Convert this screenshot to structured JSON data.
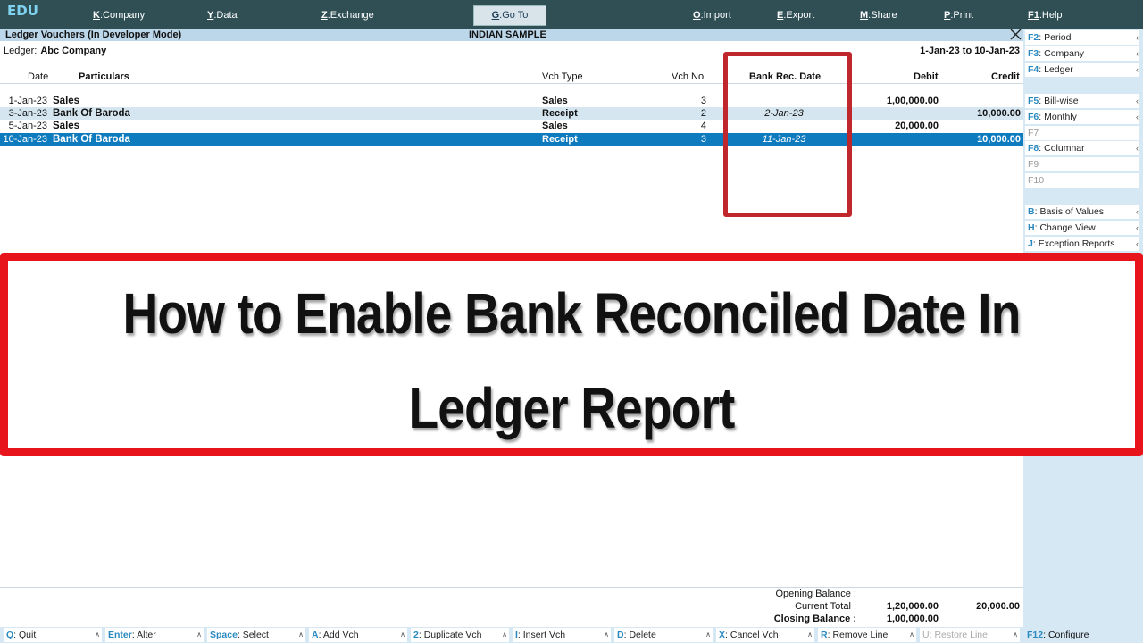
{
  "top": {
    "logo": "EDU",
    "menus": [
      {
        "key": "K",
        "label": "Company"
      },
      {
        "key": "Y",
        "label": "Data"
      },
      {
        "key": "Z",
        "label": "Exchange"
      },
      {
        "key": "G",
        "label": "Go To"
      },
      {
        "key": "O",
        "label": "Import"
      },
      {
        "key": "E",
        "label": "Export"
      },
      {
        "key": "M",
        "label": "Share"
      },
      {
        "key": "P",
        "label": "Print"
      },
      {
        "key": "F1",
        "label": "Help"
      }
    ]
  },
  "title": {
    "screen": "Ledger Vouchers (In Developer Mode)",
    "company": "INDIAN SAMPLE"
  },
  "ledger": {
    "label": "Ledger:",
    "name": "Abc Company",
    "period": "1-Jan-23 to 10-Jan-23"
  },
  "columns": {
    "date": "Date",
    "particulars": "Particulars",
    "vch_type": "Vch Type",
    "vch_no": "Vch No.",
    "bank_rec": "Bank Rec. Date",
    "debit": "Debit",
    "credit": "Credit"
  },
  "rows": [
    {
      "date": "1-Jan-23",
      "particulars": "Sales",
      "vch_type": "Sales",
      "vch_no": "3",
      "bank_rec": "",
      "debit": "1,00,000.00",
      "credit": ""
    },
    {
      "date": "3-Jan-23",
      "particulars": "Bank Of Baroda",
      "vch_type": "Receipt",
      "vch_no": "2",
      "bank_rec": "2-Jan-23",
      "debit": "",
      "credit": "10,000.00"
    },
    {
      "date": "5-Jan-23",
      "particulars": "Sales",
      "vch_type": "Sales",
      "vch_no": "4",
      "bank_rec": "",
      "debit": "20,000.00",
      "credit": ""
    },
    {
      "date": "10-Jan-23",
      "particulars": "Bank Of Baroda",
      "vch_type": "Receipt",
      "vch_no": "3",
      "bank_rec": "11-Jan-23",
      "debit": "",
      "credit": "10,000.00"
    }
  ],
  "side": [
    {
      "key": "F2",
      "label": "Period",
      "arrow": true
    },
    {
      "key": "F3",
      "label": "Company",
      "arrow": true
    },
    {
      "key": "F4",
      "label": "Ledger",
      "arrow": true
    },
    {
      "key": "F5",
      "label": "Bill-wise",
      "arrow": true
    },
    {
      "key": "F6",
      "label": "Monthly",
      "arrow": true
    },
    {
      "key": "F7",
      "label": "",
      "arrow": false
    },
    {
      "key": "F8",
      "label": "Columnar",
      "arrow": true
    },
    {
      "key": "F9",
      "label": "",
      "arrow": false
    },
    {
      "key": "F10",
      "label": "",
      "arrow": false
    },
    {
      "key": "B",
      "label": "Basis of Values",
      "arrow": true
    },
    {
      "key": "H",
      "label": "Change View",
      "arrow": true
    },
    {
      "key": "J",
      "label": "Exception Reports",
      "arrow": true
    }
  ],
  "banner": {
    "line1": "How to Enable Bank Reconciled Date In",
    "line2": "Ledger Report"
  },
  "totals": {
    "opening_label": "Opening Balance :",
    "current_label": "Current Total :",
    "current_debit": "1,20,000.00",
    "current_credit": "20,000.00",
    "closing_label": "Closing Balance :",
    "closing_debit": "1,00,000.00"
  },
  "bottom": [
    {
      "key": "Q",
      "label": "Quit"
    },
    {
      "key": "Enter",
      "label": "Alter"
    },
    {
      "key": "Space",
      "label": "Select"
    },
    {
      "key": "A",
      "label": "Add Vch"
    },
    {
      "key": "2",
      "label": "Duplicate Vch"
    },
    {
      "key": "I",
      "label": "Insert Vch"
    },
    {
      "key": "D",
      "label": "Delete"
    },
    {
      "key": "X",
      "label": "Cancel Vch"
    },
    {
      "key": "R",
      "label": "Remove Line"
    },
    {
      "key": "U",
      "label": "Restore Line"
    }
  ],
  "configure": {
    "key": "F12",
    "label": "Configure"
  },
  "colors": {
    "highlight": "#e8141c",
    "selected_row": "#0f7bbf",
    "topbar": "#2f4f55"
  }
}
